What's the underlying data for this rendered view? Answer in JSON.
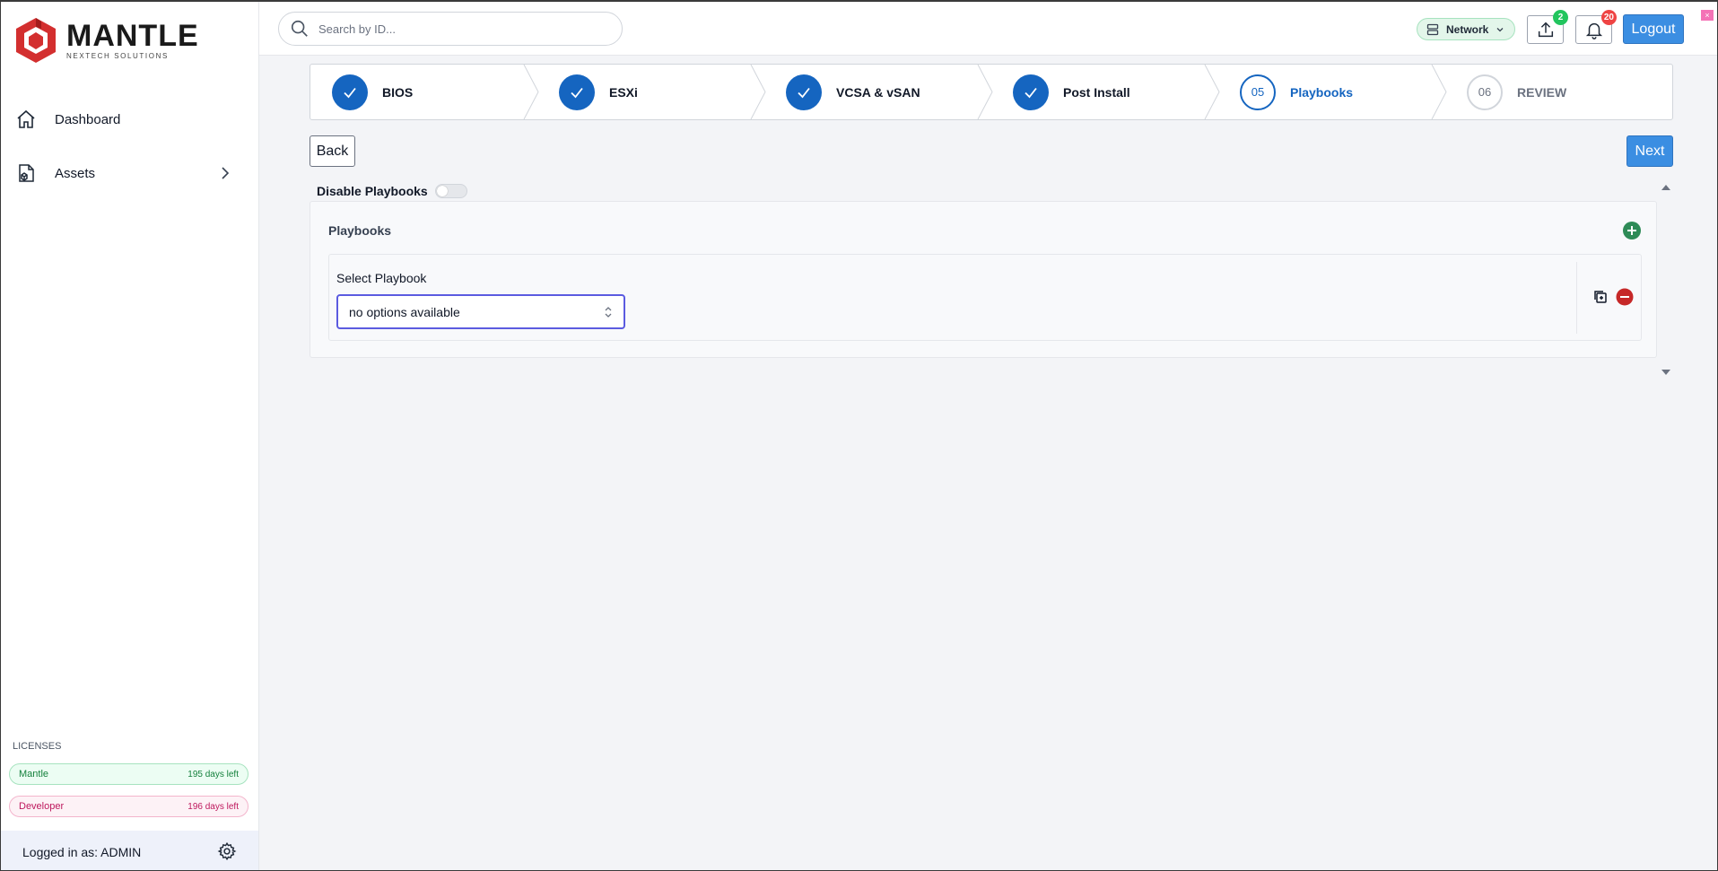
{
  "brand": {
    "name": "MANTLE",
    "tagline": "NEXTECH SOLUTIONS",
    "accent": "#d32f2f"
  },
  "sidebar": {
    "items": [
      {
        "label": "Dashboard",
        "icon": "home-icon"
      },
      {
        "label": "Assets",
        "icon": "cube-icon"
      }
    ],
    "licenses_title": "LICENSES",
    "licenses": [
      {
        "name": "Mantle",
        "days": "195 days left",
        "color": "#15803d"
      },
      {
        "name": "Developer",
        "days": "196 days left",
        "color": "#be185d"
      }
    ],
    "logged_in": "Logged in as: ADMIN"
  },
  "topbar": {
    "search_placeholder": "Search by ID...",
    "network_label": "Network",
    "upload_badge": "2",
    "notifications_badge": "20",
    "logout_label": "Logout"
  },
  "stepper": {
    "steps": [
      {
        "label": "BIOS",
        "state": "done"
      },
      {
        "label": "ESXi",
        "state": "done"
      },
      {
        "label": "VCSA & vSAN",
        "state": "done"
      },
      {
        "label": "Post Install",
        "state": "done"
      },
      {
        "label": "Playbooks",
        "state": "current",
        "number": "05"
      },
      {
        "label": "REVIEW",
        "state": "future",
        "number": "06"
      }
    ],
    "primary_color": "#1565c0"
  },
  "actions": {
    "back_label": "Back",
    "next_label": "Next"
  },
  "playbooks": {
    "disable_label": "Disable Playbooks",
    "disable_on": false,
    "panel_title": "Playbooks",
    "select_label": "Select Playbook",
    "select_value": "no options available"
  }
}
